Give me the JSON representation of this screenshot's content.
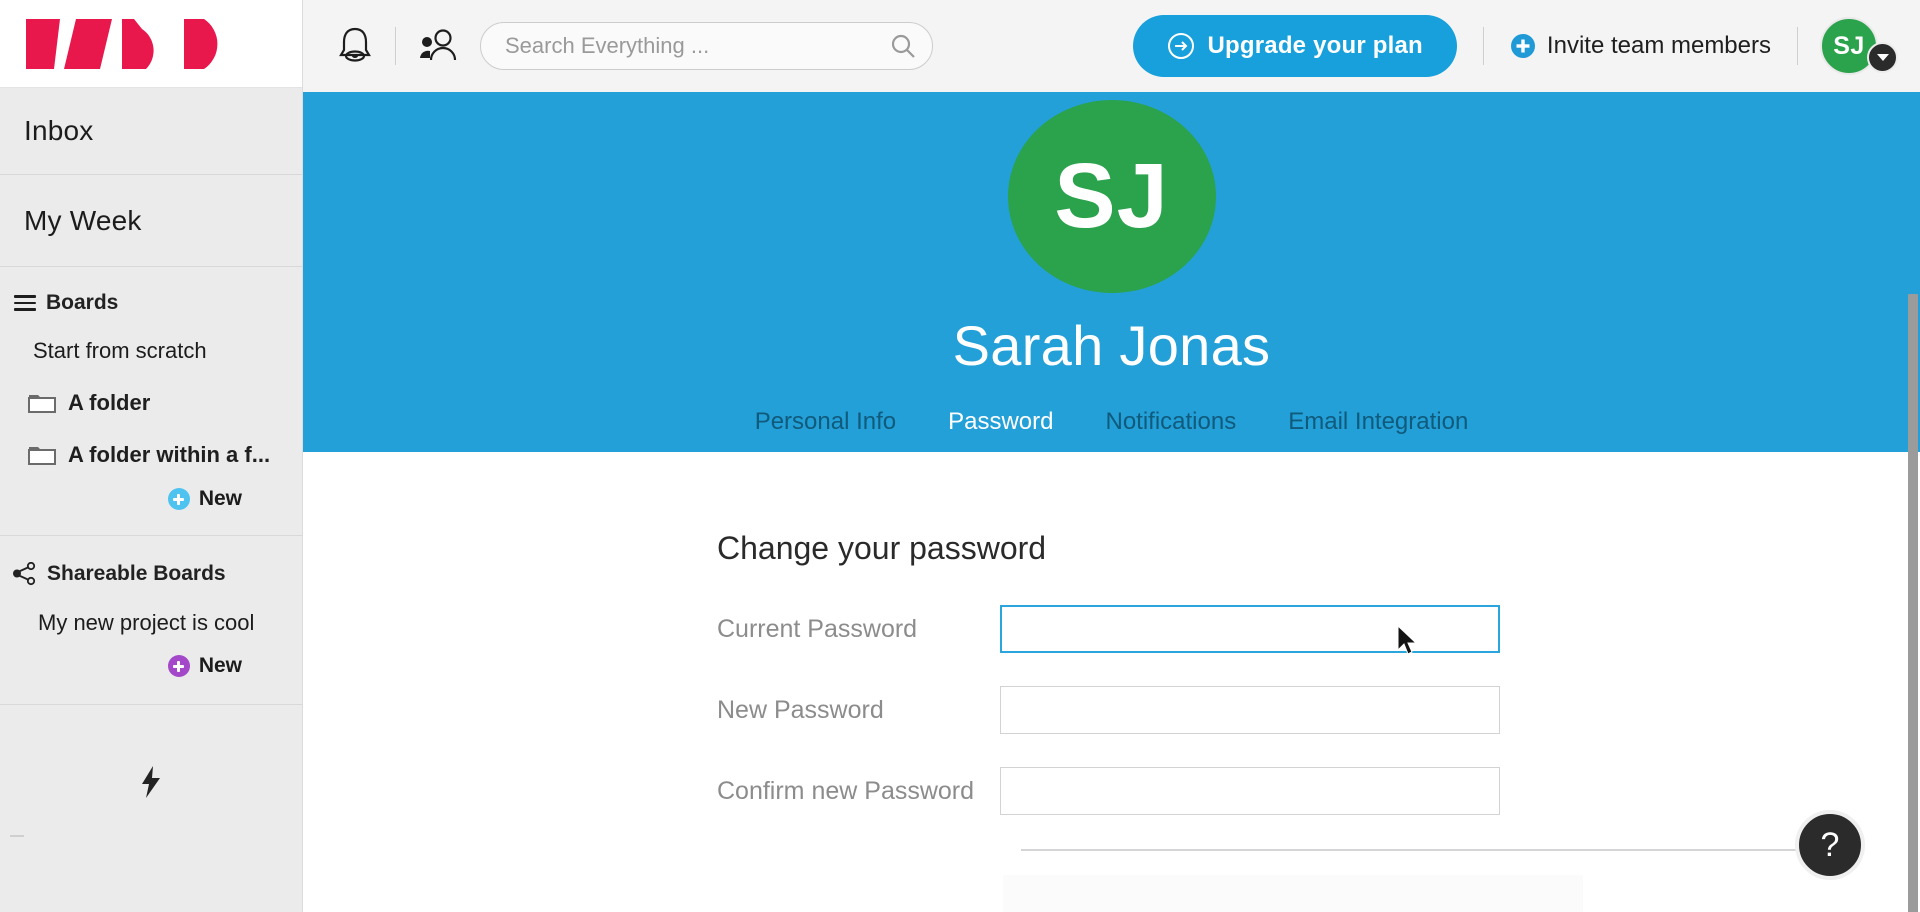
{
  "brand": {
    "logo_name": "monday-logo",
    "logo_color": "#e8174c"
  },
  "sidebar": {
    "inbox_label": "Inbox",
    "my_week_label": "My Week",
    "boards_label": "Boards",
    "boards_items": [
      {
        "label": "Start from scratch",
        "icon": "",
        "bold": false
      },
      {
        "label": "A folder",
        "icon": "folder-icon",
        "bold": true
      },
      {
        "label": "A folder within a f...",
        "icon": "folder-icon",
        "bold": true
      }
    ],
    "boards_new_label": "New",
    "boards_new_color": "#4fc3f0",
    "shareable_label": "Shareable Boards",
    "shareable_items": [
      {
        "label": "My new project is cool"
      }
    ],
    "shareable_new_label": "New",
    "shareable_new_color": "#a348c9",
    "bolt_icon": "lightning-bolt-icon"
  },
  "topbar": {
    "bell_icon": "notification-bell-icon",
    "people_icon": "team-members-icon",
    "search": {
      "placeholder": "Search Everything ...",
      "value": "",
      "icon": "search-icon"
    },
    "upgrade_label": "Upgrade your plan",
    "upgrade_icon": "arrow-right-circle-icon",
    "upgrade_color": "#17a0db",
    "invite_label": "Invite team members",
    "invite_icon": "plus-circle-icon",
    "invite_icon_color": "#1f9ad6",
    "avatar_initials": "SJ",
    "avatar_color": "#2ba24c",
    "caret_icon": "chevron-down-icon"
  },
  "profile": {
    "avatar_initials": "SJ",
    "avatar_color": "#2ba24c",
    "hero_color": "#23a0d8",
    "name": "Sarah Jonas",
    "tabs": [
      {
        "label": "Personal Info",
        "active": false
      },
      {
        "label": "Password",
        "active": true
      },
      {
        "label": "Notifications",
        "active": false
      },
      {
        "label": "Email Integration",
        "active": false
      }
    ]
  },
  "password_form": {
    "title": "Change your password",
    "fields": [
      {
        "label": "Current Password",
        "value": "",
        "focused": true
      },
      {
        "label": "New Password",
        "value": "",
        "focused": false
      },
      {
        "label": "Confirm new Password",
        "value": "",
        "focused": false
      }
    ]
  },
  "help": {
    "label": "?",
    "icon": "question-mark-icon"
  }
}
